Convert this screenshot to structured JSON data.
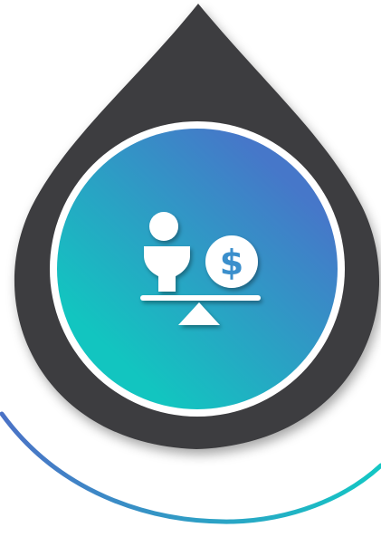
{
  "graphic": {
    "icon": "scale-balance-person-vs-money-icon",
    "symbol": "$"
  },
  "colors": {
    "drop": "#3d3d3f",
    "ring": "#ffffff",
    "gradient_start": "#12c5c0",
    "gradient_end": "#4677c9",
    "arc_start": "#4b72c6",
    "arc_end": "#13c7c4",
    "icon": "#ffffff",
    "coin_text": "#3a8fcc"
  }
}
